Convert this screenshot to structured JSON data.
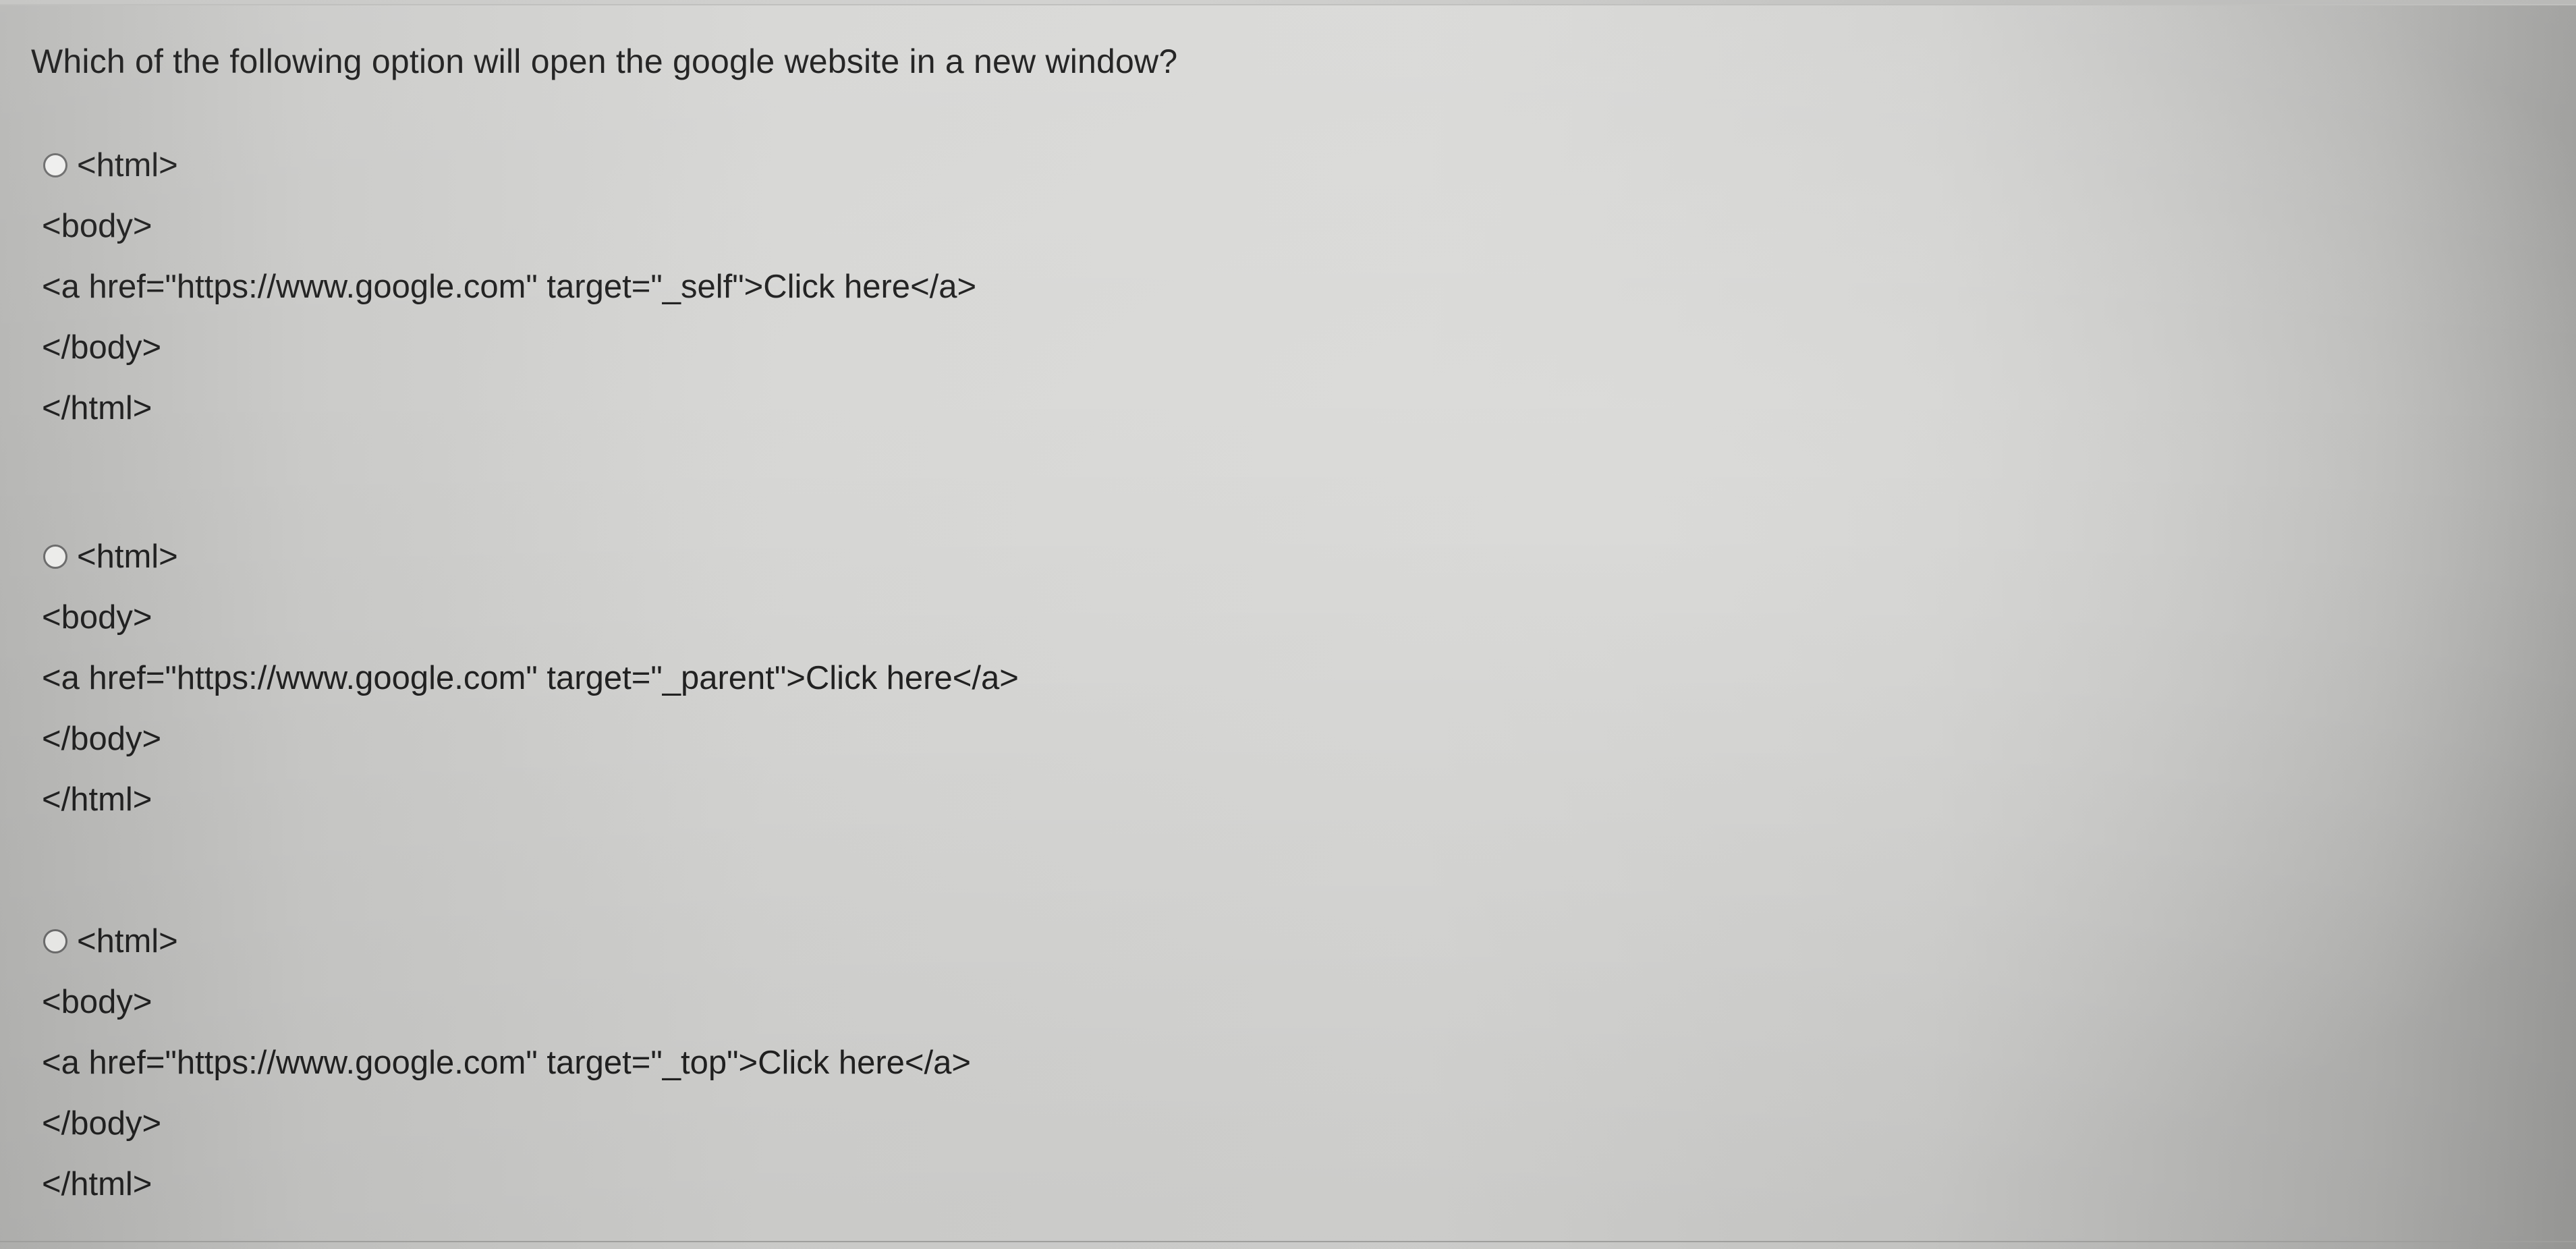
{
  "question": "Which of the following option will open the google website in a new window?",
  "options": [
    {
      "lines": [
        "<html>",
        "<body>",
        "<a href=\"https://www.google.com\" target=\"_self\">Click here</a>",
        "</body>",
        "</html>"
      ]
    },
    {
      "lines": [
        "<html>",
        "<body>",
        "<a href=\"https://www.google.com\" target=\"_parent\">Click here</a>",
        "</body>",
        "</html>"
      ]
    },
    {
      "lines": [
        "<html>",
        "<body>",
        "<a href=\"https://www.google.com\" target=\"_top\">Click here</a>",
        "</body>",
        "</html>"
      ]
    }
  ]
}
